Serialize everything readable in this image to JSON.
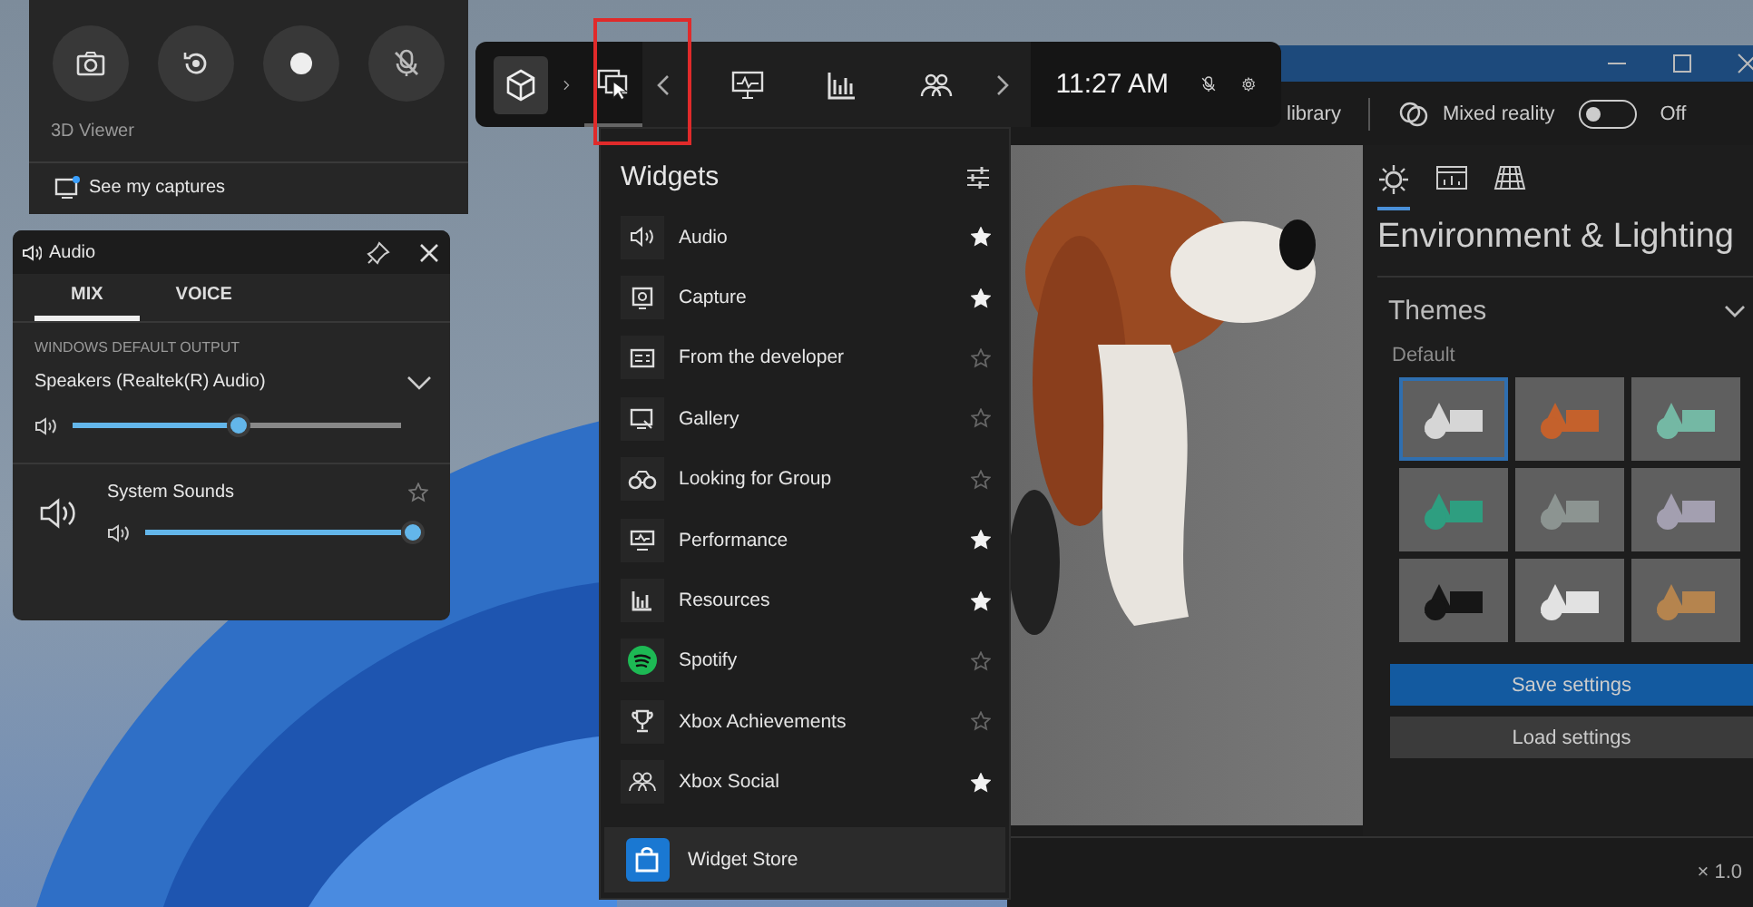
{
  "capture_widget": {
    "app_name": "3D Viewer",
    "link": "See my captures",
    "mic_muted": true
  },
  "audio_widget": {
    "title": "Audio",
    "tabs": [
      {
        "label": "MIX",
        "selected": true
      },
      {
        "label": "VOICE",
        "selected": false
      }
    ],
    "section_label": "WINDOWS DEFAULT OUTPUT",
    "output_device": "Speakers (Realtek(R) Audio)",
    "master": {
      "level": 0.47
    },
    "apps": [
      {
        "name": "System Sounds",
        "favorite": false,
        "level": 1.0
      }
    ]
  },
  "game_bar": {
    "buttons": [
      {
        "kind": "viewer",
        "selected": true,
        "highlighted": false
      },
      {
        "kind": "widgets",
        "selected": false,
        "highlighted": true
      }
    ],
    "pinned": [
      {
        "kind": "performance"
      },
      {
        "kind": "resources"
      },
      {
        "kind": "social"
      }
    ],
    "time": "11:27 AM",
    "mic_muted": true
  },
  "widgets_menu": {
    "title": "Widgets",
    "items": [
      {
        "label": "Audio",
        "kind": "audio",
        "favorite": true
      },
      {
        "label": "Capture",
        "kind": "capture",
        "favorite": true
      },
      {
        "label": "From the developer",
        "kind": "developer",
        "favorite": false
      },
      {
        "label": "Gallery",
        "kind": "gallery",
        "favorite": false
      },
      {
        "label": "Looking for Group",
        "kind": "lfg",
        "favorite": false
      },
      {
        "label": "Performance",
        "kind": "performance",
        "favorite": true
      },
      {
        "label": "Resources",
        "kind": "resources",
        "favorite": true
      },
      {
        "label": "Spotify",
        "kind": "spotify",
        "favorite": false
      },
      {
        "label": "Xbox Achievements",
        "kind": "achievements",
        "favorite": false
      },
      {
        "label": "Xbox Social",
        "kind": "social",
        "favorite": true
      }
    ],
    "store": "Widget Store"
  },
  "viewer_app": {
    "toolbar": {
      "library": "library",
      "mixed_reality": {
        "label": "Mixed reality",
        "on": false,
        "state": "Off"
      }
    },
    "panel": {
      "tabs": [
        {
          "kind": "lighting",
          "selected": true
        },
        {
          "kind": "stats",
          "selected": false
        },
        {
          "kind": "grid",
          "selected": false
        }
      ],
      "title": "Environment & Lighting",
      "section": "Themes",
      "expanded": true,
      "group": "Default",
      "themes": [
        {
          "color": "#d6d6d6",
          "selected": true
        },
        {
          "color": "#c4612c",
          "selected": false
        },
        {
          "color": "#74b8a4",
          "selected": false
        },
        {
          "color": "#2e9e80",
          "selected": false
        },
        {
          "color": "#8c9491",
          "selected": false
        },
        {
          "color": "#a39fb0",
          "selected": false
        },
        {
          "color": "#161616",
          "selected": false
        },
        {
          "color": "#e2e2e2",
          "selected": false
        },
        {
          "color": "#b5844e",
          "selected": false
        }
      ],
      "buttons": [
        {
          "label": "Save settings",
          "kind": "primary"
        },
        {
          "label": "Load settings",
          "kind": "secondary"
        }
      ]
    },
    "zoom": "× 1.0"
  }
}
